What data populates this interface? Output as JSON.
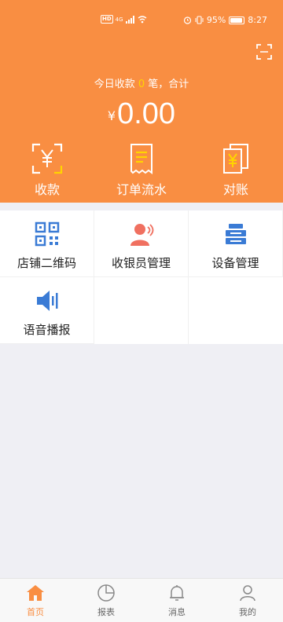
{
  "status_bar": {
    "network": "HD",
    "signal": "4G",
    "battery": "95%",
    "battery_level": 0.95,
    "time": "8:27"
  },
  "header": {
    "summary_prefix": "今日收款",
    "summary_count": "0",
    "summary_suffix": "笔，合计",
    "currency": "¥",
    "amount": "0.00",
    "actions": [
      {
        "label": "收款",
        "icon": "yuan-scan-icon"
      },
      {
        "label": "订单流水",
        "icon": "receipt-icon"
      },
      {
        "label": "对账",
        "icon": "reconcile-icon"
      }
    ]
  },
  "grid": [
    {
      "label": "店铺二维码",
      "icon": "qr-code-icon"
    },
    {
      "label": "收银员管理",
      "icon": "cashier-icon"
    },
    {
      "label": "设备管理",
      "icon": "device-icon"
    },
    {
      "label": "语音播报",
      "icon": "speaker-icon"
    }
  ],
  "tabbar": [
    {
      "label": "首页",
      "icon": "home-icon",
      "active": true
    },
    {
      "label": "报表",
      "icon": "pie-chart-icon",
      "active": false
    },
    {
      "label": "消息",
      "icon": "bell-icon",
      "active": false
    },
    {
      "label": "我的",
      "icon": "user-icon",
      "active": false
    }
  ],
  "colors": {
    "brand": "#f98e42",
    "highlight": "#ffd400",
    "blue": "#3a7bd5",
    "cashier_red": "#f07060"
  }
}
